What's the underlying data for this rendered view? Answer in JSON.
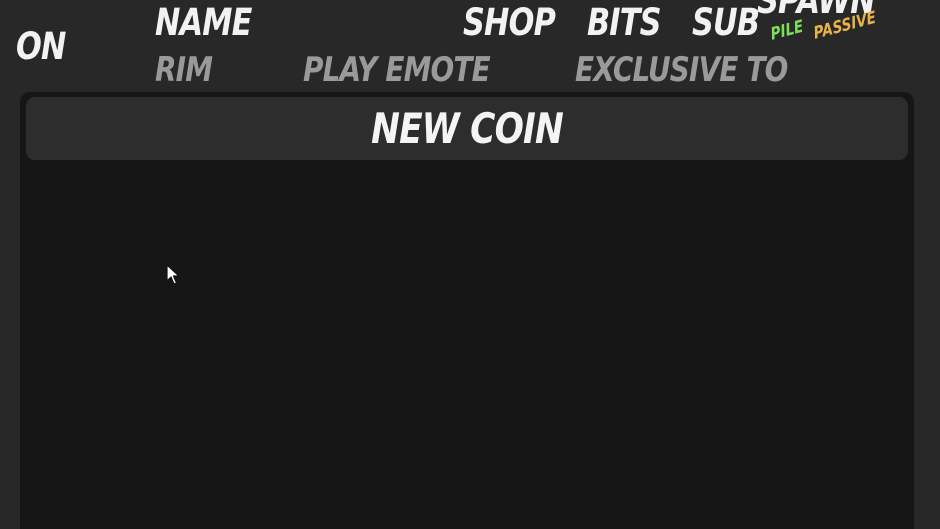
{
  "header": {
    "on": "ON",
    "name": "NAME",
    "shop": "SHOP",
    "bits": "BITS",
    "sub": "SUB",
    "spawn": "SPAWN",
    "pile": "PILE",
    "passive": "PASSIVE",
    "rim": "RIM",
    "play_emote": "PLAY EMOTE",
    "exclusive_to": "EXCLUSIVE TO"
  },
  "actions": {
    "new_coin": "NEW COIN"
  },
  "colors": {
    "background": "#282828",
    "panel": "#161616",
    "button": "#2d2d2d",
    "primary_text": "#f2f2f2",
    "secondary_text": "#9a9a9a",
    "pile": "#7ee05a",
    "passive": "#e8b44a"
  },
  "icons": {
    "cursor": "mouse-pointer-icon"
  }
}
